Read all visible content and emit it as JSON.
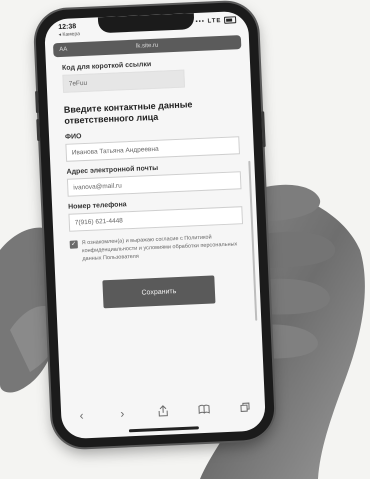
{
  "status_bar": {
    "time": "12:38",
    "back_app": "◂ Камера",
    "signal": "▪▪▪ LTE"
  },
  "browser": {
    "text_size": "AA",
    "host": "lk.site.ru",
    "toolbar_icons": [
      "back-icon",
      "forward-icon",
      "share-icon",
      "bookmarks-icon",
      "tabs-icon"
    ]
  },
  "form": {
    "short_code": {
      "label": "Код для короткой ссылки",
      "value": "7eFuu"
    },
    "section_title": "Введите контактные данные ответственного лица",
    "full_name": {
      "label": "ФИО",
      "value": "Иванова Татьяна Андреевна"
    },
    "email": {
      "label": "Адрес электронной почты",
      "value": "ivanova@mail.ru"
    },
    "phone": {
      "label": "Номер телефона",
      "value": "7(916) 621-4448"
    },
    "consent": {
      "checked": true,
      "text": "Я ознакомлен(а) и выражаю согласие с Политикой конфиденциальности и условиями обработки персональных данных Пользователя"
    },
    "save_label": "Сохранить"
  }
}
